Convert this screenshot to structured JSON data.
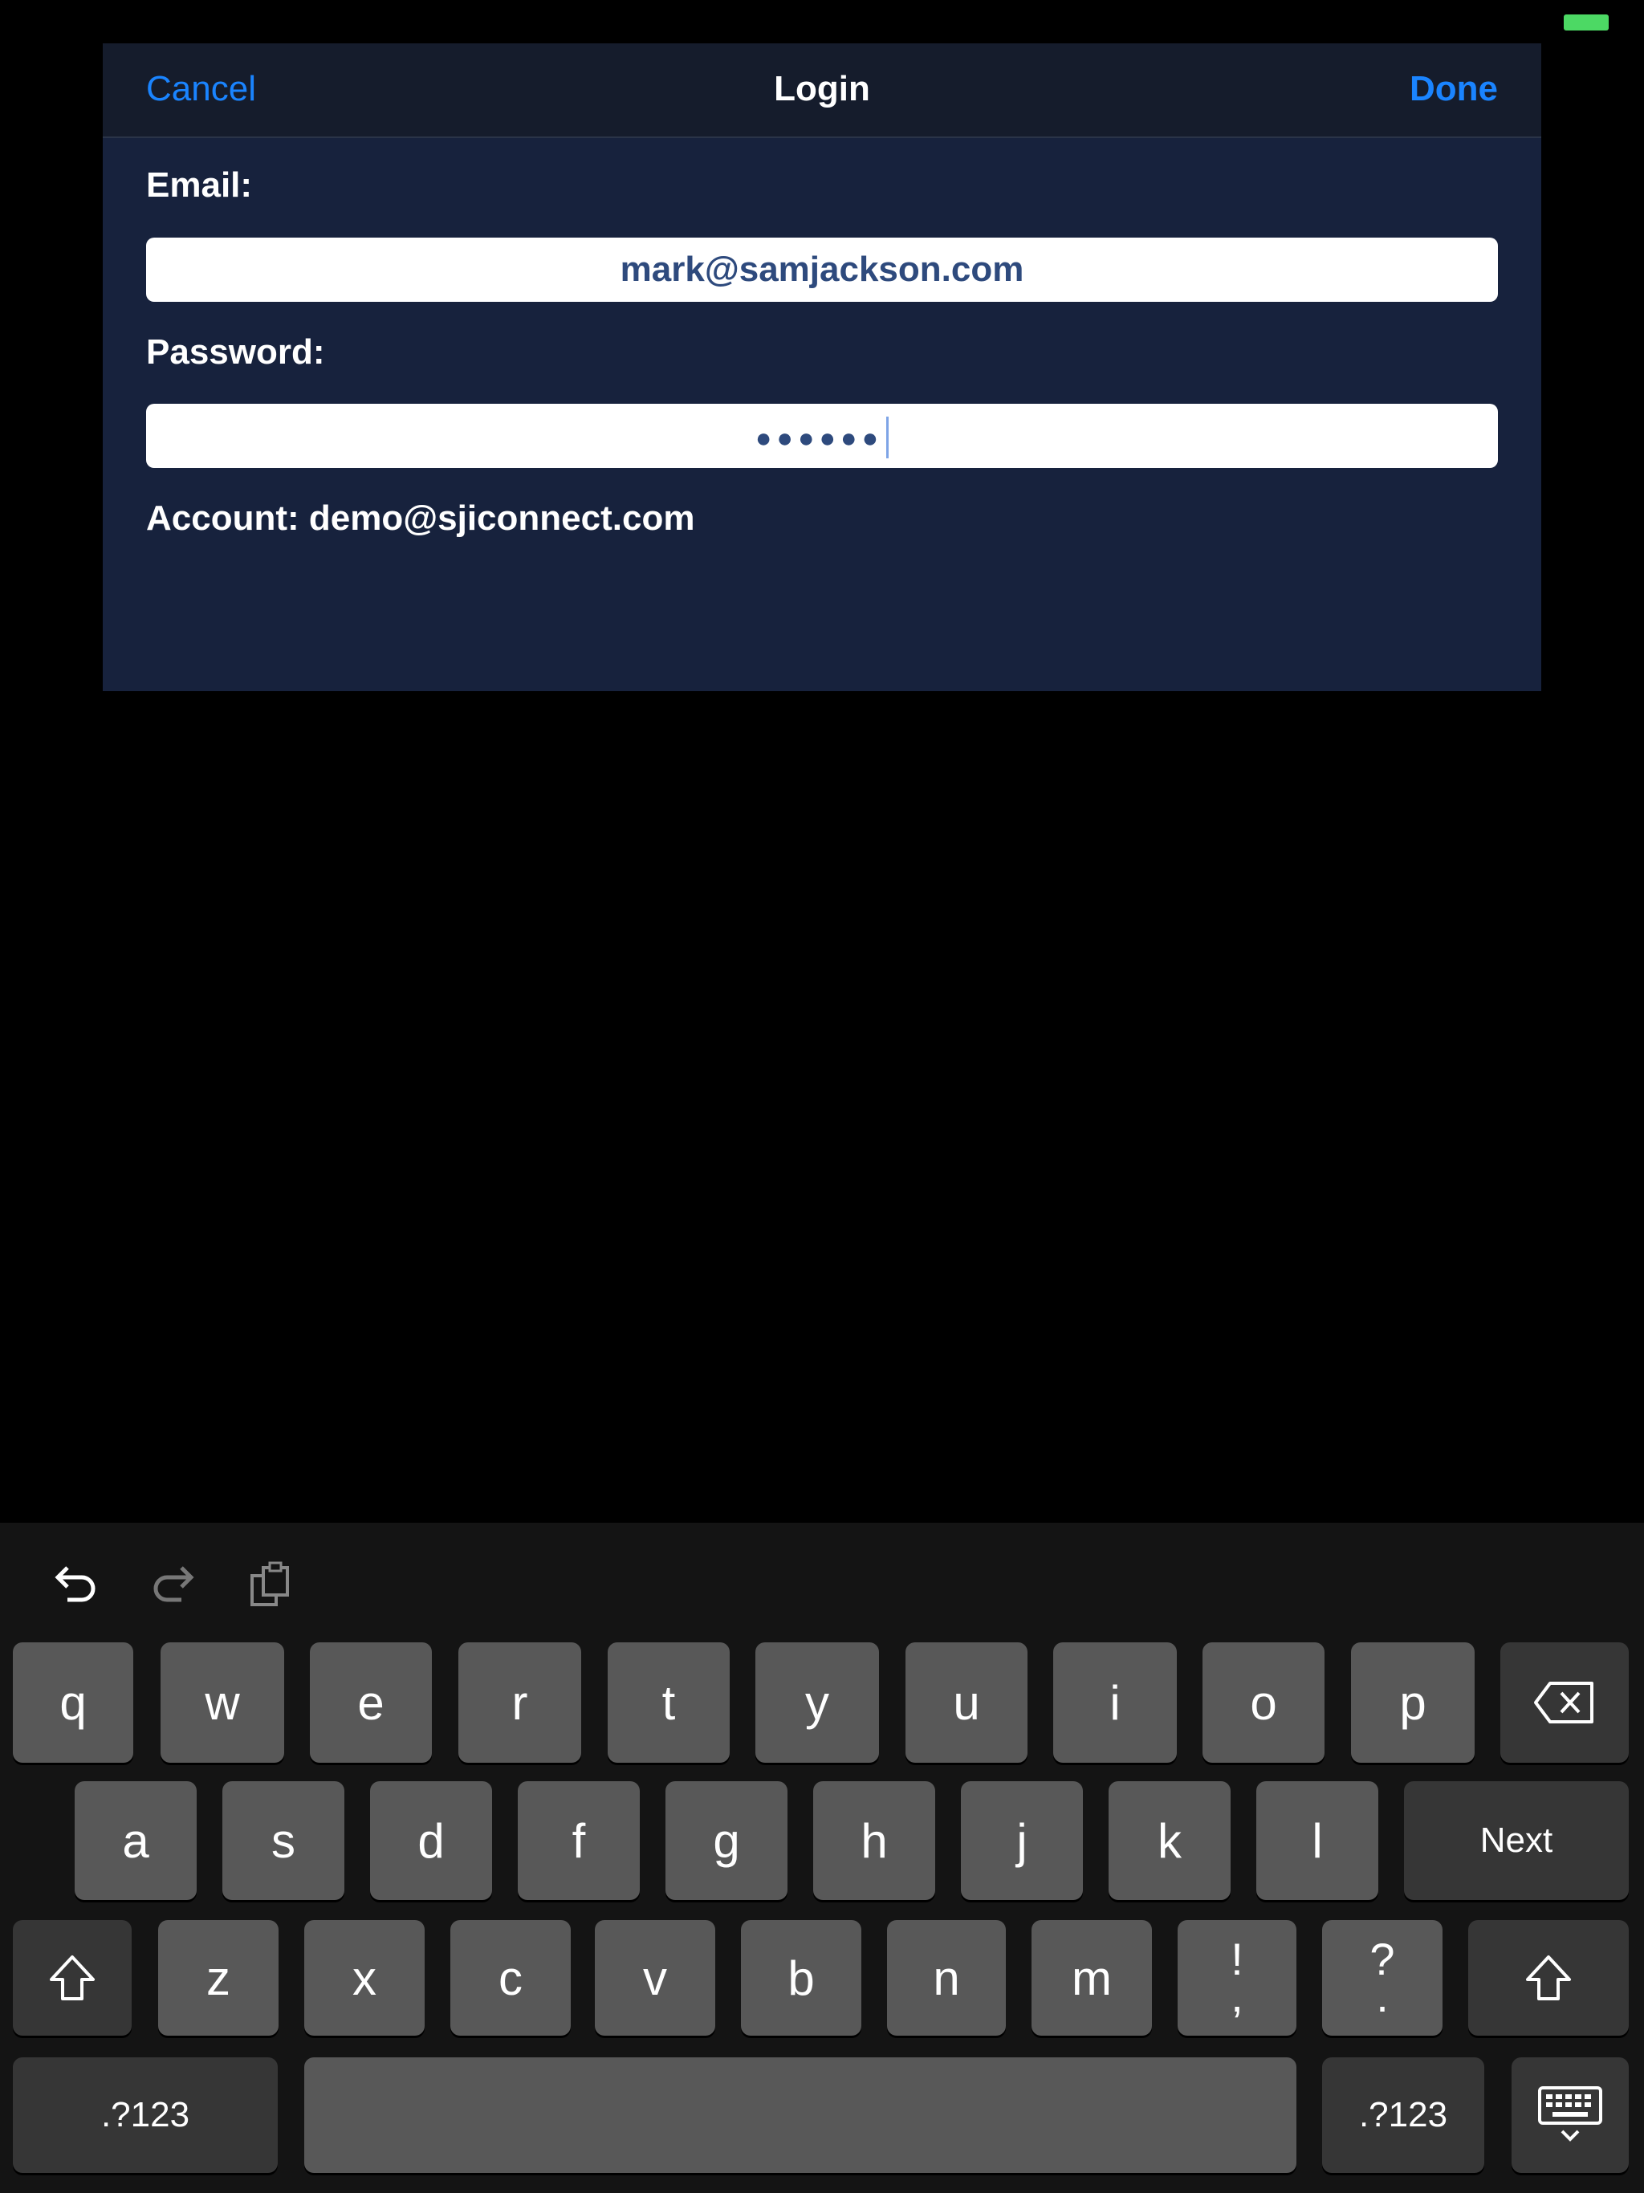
{
  "status_bar": {
    "battery_color": "#4cd964"
  },
  "nav": {
    "cancel": "Cancel",
    "title": "Login",
    "done": "Done"
  },
  "form": {
    "email_label": "Email:",
    "email_value": "mark@samjackson.com",
    "password_label": "Password:",
    "password_value": "●●●●●●",
    "account_text": "Account: demo@sjiconnect.com"
  },
  "keyboard": {
    "toolbar": [
      "undo-icon",
      "redo-icon",
      "paste-icon"
    ],
    "row1": [
      "q",
      "w",
      "e",
      "r",
      "t",
      "y",
      "u",
      "i",
      "o",
      "p"
    ],
    "row2": [
      "a",
      "s",
      "d",
      "f",
      "g",
      "h",
      "j",
      "k",
      "l"
    ],
    "next": "Next",
    "row3": [
      "z",
      "x",
      "c",
      "v",
      "b",
      "n",
      "m"
    ],
    "punct1": {
      "top": "!",
      "bottom": ","
    },
    "punct2": {
      "top": "?",
      "bottom": "."
    },
    "numbers": ".?123"
  },
  "colors": {
    "accent": "#1a84ff",
    "modal_bg": "#17223d",
    "field_text": "#2e4a7d"
  }
}
